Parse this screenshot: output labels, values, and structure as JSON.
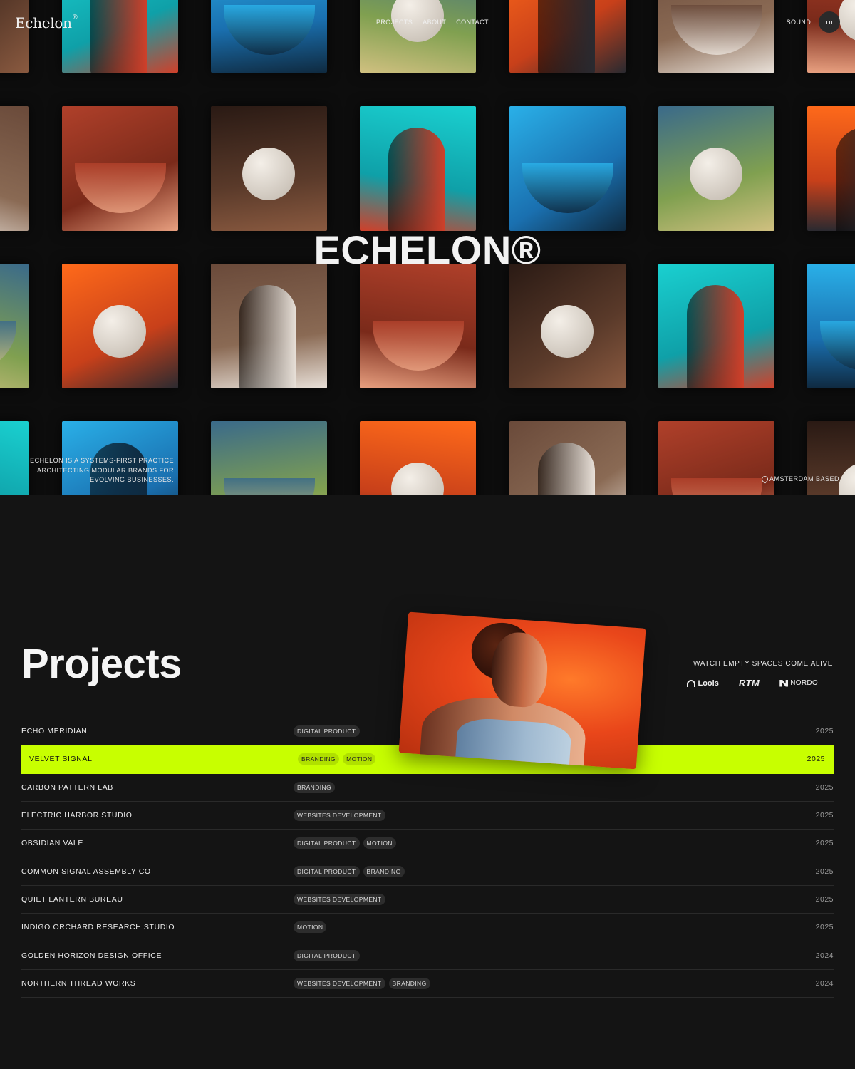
{
  "brand": {
    "logo": "Echelon",
    "logo_mark": "®"
  },
  "nav": {
    "projects": "PROJECTS",
    "about": "ABOUT",
    "contact": "CONTACT"
  },
  "sound": {
    "label": "SOUND:"
  },
  "hero": {
    "title": "ECHELON®",
    "description": "ECHELON IS A SYSTEMS-FIRST PRACTICE ARCHITECTING MODULAR BRANDS FOR EVOLVING BUSINESSES.",
    "location": "AMSTERDAM BASED"
  },
  "projects": {
    "title": "Projects",
    "watch_label": "WATCH EMPTY SPACES COME ALIVE",
    "partners": [
      "Loois",
      "RTM",
      "NORDO"
    ],
    "rows": [
      {
        "name": "ECHO MERIDIAN",
        "tags": [
          "DIGITAL PRODUCT"
        ],
        "year": "2025"
      },
      {
        "name": "VELVET SIGNAL",
        "tags": [
          "BRANDING",
          "MOTION"
        ],
        "year": "2025",
        "active": true
      },
      {
        "name": "CARBON PATTERN LAB",
        "tags": [
          "BRANDING"
        ],
        "year": "2025"
      },
      {
        "name": "ELECTRIC HARBOR STUDIO",
        "tags": [
          "WEBSITES DEVELOPMENT"
        ],
        "year": "2025"
      },
      {
        "name": "OBSIDIAN VALE",
        "tags": [
          "DIGITAL PRODUCT",
          "MOTION"
        ],
        "year": "2025"
      },
      {
        "name": "COMMON SIGNAL ASSEMBLY CO",
        "tags": [
          "DIGITAL PRODUCT",
          "BRANDING"
        ],
        "year": "2025"
      },
      {
        "name": "QUIET LANTERN BUREAU",
        "tags": [
          "WEBSITES DEVELOPMENT"
        ],
        "year": "2025"
      },
      {
        "name": "INDIGO ORCHARD RESEARCH STUDIO",
        "tags": [
          "MOTION"
        ],
        "year": "2025"
      },
      {
        "name": "GOLDEN HORIZON DESIGN OFFICE",
        "tags": [
          "DIGITAL PRODUCT"
        ],
        "year": "2024"
      },
      {
        "name": "NORTHERN THREAD WORKS",
        "tags": [
          "WEBSITES DEVELOPMENT",
          "BRANDING"
        ],
        "year": "2024"
      }
    ]
  },
  "colors": {
    "accent": "#c8ff00",
    "background": "#141414",
    "hero_background": "#0d0d0d"
  }
}
